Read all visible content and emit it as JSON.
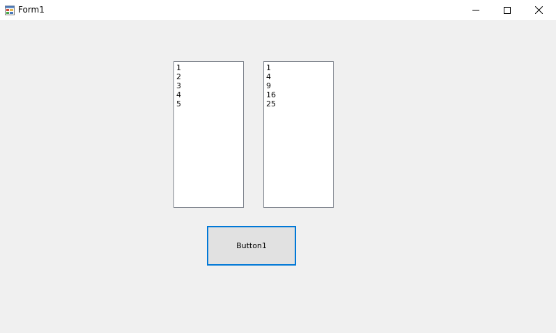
{
  "window": {
    "title": "Form1"
  },
  "listbox_1": {
    "items": [
      "1",
      "2",
      "3",
      "4",
      "5"
    ]
  },
  "listbox_2": {
    "items": [
      "1",
      "4",
      "9",
      "16",
      "25"
    ]
  },
  "button1": {
    "label": "Button1"
  },
  "colors": {
    "form_background": "#f0f0f0",
    "titlebar_background": "#ffffff",
    "button_focus_border": "#0078d7",
    "button_background": "#e1e1e1",
    "listbox_border": "#828790"
  },
  "icons": {
    "app": "form-app-icon",
    "minimize": "minimize-icon",
    "maximize": "maximize-icon",
    "close": "close-icon"
  }
}
